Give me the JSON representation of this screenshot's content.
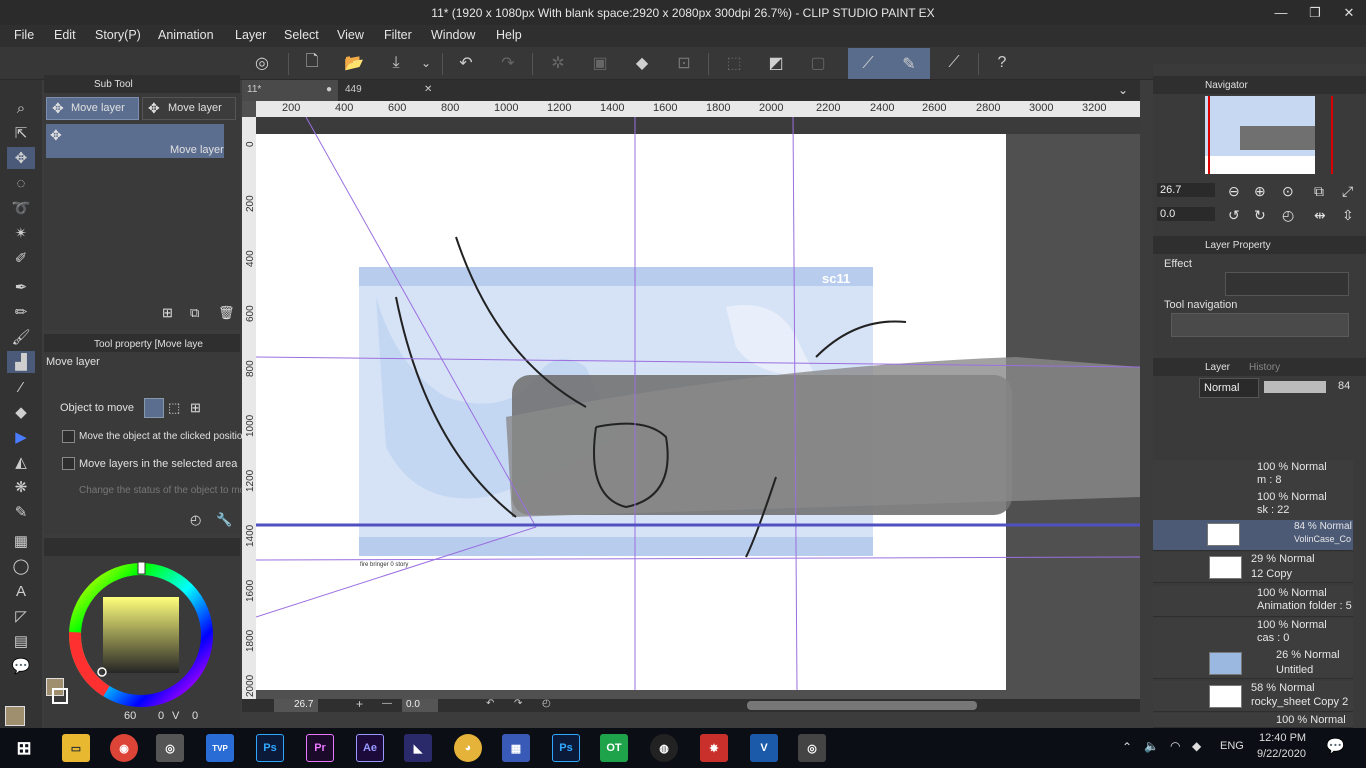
{
  "app": {
    "title": "11* (1920 x 1080px With blank space:2920 x 2080px 300dpi 26.7%)  - CLIP STUDIO PAINT EX"
  },
  "menu": [
    "File",
    "Edit",
    "Story(P)",
    "Animation",
    "Layer",
    "Select",
    "View",
    "Filter",
    "Window",
    "Help"
  ],
  "subtool": {
    "tab_label": "Sub Tool",
    "buttons": [
      "Move layer",
      "Move layer"
    ],
    "selected_item": "Move layer"
  },
  "tool_property": {
    "tab_label": "Tool property [Move laye",
    "title": "Move layer",
    "object_to_move_label": "Object to move",
    "options": [
      "Move the object at the clicked position",
      "Move layers in the selected area",
      "Change the status of the object to move"
    ]
  },
  "color": {
    "main": "#a08f6f",
    "sub": "#ffffff",
    "values": [
      "60",
      "0",
      "0"
    ],
    "labels": [
      "",
      "V"
    ]
  },
  "canvas": {
    "tabs": [
      "11*",
      "449"
    ],
    "ruler_top": [
      "200",
      "400",
      "600",
      "800",
      "1000",
      "1200",
      "1400",
      "1600",
      "1800",
      "2000",
      "2200",
      "2400",
      "2600",
      "2800",
      "3000",
      "3200"
    ],
    "ruler_left": [
      "0",
      "200",
      "400",
      "600",
      "800",
      "1000",
      "1200",
      "1400",
      "1600",
      "1800",
      "2000"
    ],
    "frame_label": "sc11",
    "caption": "fire bringer 0 story",
    "zoom": "26.7",
    "angle": "0.0"
  },
  "navigator": {
    "tab_label": "Navigator",
    "zoom": "26.7",
    "angle": "0.0"
  },
  "layer_property": {
    "tab_label": "Layer Property",
    "effect_label": "Effect",
    "tool_nav_label": "Tool navigation"
  },
  "layers_panel": {
    "tab_label": "Layer",
    "history_label": "History",
    "blend_mode": "Normal",
    "opacity": "84",
    "layers": [
      {
        "line1": "100 % Normal",
        "line2": "m : 8"
      },
      {
        "line1": "100 % Normal",
        "line2": "sk : 22"
      },
      {
        "line1": "84 % Normal",
        "line2": "VolinCase_Co"
      },
      {
        "line1": "29 % Normal",
        "line2": "12 Copy"
      },
      {
        "line1": "100 % Normal",
        "line2": "Animation folder : 5"
      },
      {
        "line1": "100 % Normal",
        "line2": "cas : 0"
      },
      {
        "line1": "26 % Normal",
        "line2": "Untitled"
      },
      {
        "line1": "58 % Normal",
        "line2": "rocky_sheet Copy 2"
      },
      {
        "line1": "100 % Normal",
        "line2": ""
      }
    ]
  },
  "taskbar": {
    "time": "12:40 PM",
    "date": "9/22/2020",
    "lang": "ENG",
    "apps": [
      "TVP",
      "Ps",
      "Pr",
      "Ae",
      "Ps",
      "OT",
      "V"
    ]
  }
}
